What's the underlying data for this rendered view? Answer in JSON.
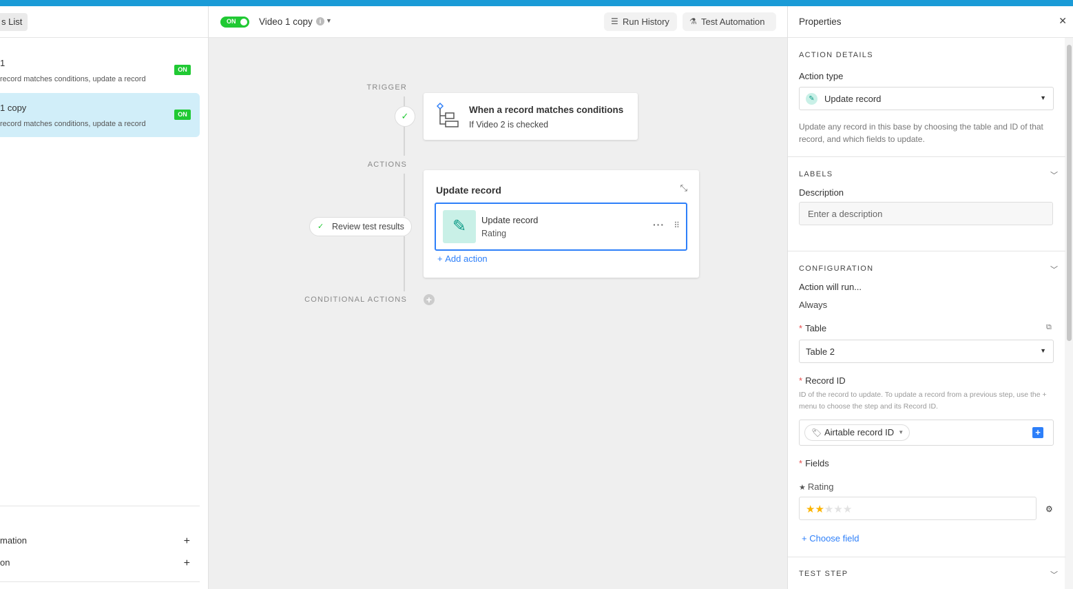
{
  "sidebar": {
    "list_label": "s List",
    "automations": [
      {
        "name": "1",
        "description": "record matches conditions, update a record",
        "status": "ON"
      },
      {
        "name": "1 copy",
        "description": "record matches conditions, update a record",
        "status": "ON"
      }
    ],
    "footer_items": [
      {
        "label": "mation",
        "action": "+"
      },
      {
        "label": "on",
        "action": "+"
      }
    ]
  },
  "header": {
    "toggle_label": "ON",
    "automation_title": "Video 1 copy",
    "run_history": "Run History",
    "test_automation": "Test Automation"
  },
  "canvas": {
    "trigger_label": "TRIGGER",
    "actions_label": "ACTIONS",
    "conditional_label": "CONDITIONAL ACTIONS",
    "trigger_title": "When a record matches conditions",
    "trigger_subtitle": "If Video 2 is checked",
    "action_card_title": "Update record",
    "step_title": "Update record",
    "step_subtitle": "Rating",
    "add_action": "Add action",
    "review_test": "Review test results"
  },
  "properties": {
    "title": "Properties",
    "action_details_label": "ACTION DETAILS",
    "action_type_label": "Action type",
    "action_type_value": "Update record",
    "action_type_help": "Update any record in this base by choosing the table and ID of that record, and which fields to update.",
    "labels_label": "LABELS",
    "description_label": "Description",
    "description_placeholder": "Enter a description",
    "configuration_label": "CONFIGURATION",
    "run_label": "Action will run...",
    "run_value": "Always",
    "table_label": "Table",
    "table_value": "Table 2",
    "record_id_label": "Record ID",
    "record_id_help": "ID of the record to update. To update a record from a previous step, use the + menu to choose the step and its Record ID.",
    "record_id_token": "Airtable record ID",
    "fields_label": "Fields",
    "rating_label": "Rating",
    "rating_value": 2,
    "rating_max": 5,
    "choose_field": "Choose field",
    "test_step_label": "TEST STEP"
  },
  "colors": {
    "accent_blue": "#2d7ff9",
    "on_green": "#20c933",
    "top_bar": "#1a9bd7",
    "star": "#fcb400",
    "selected_row": "#d1eef9"
  }
}
